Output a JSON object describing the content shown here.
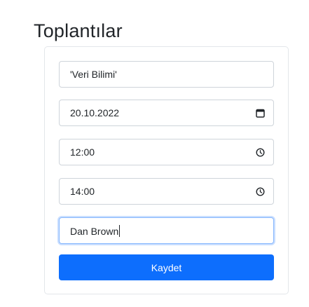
{
  "page": {
    "title": "Toplantılar"
  },
  "form": {
    "topic": {
      "value": "'Veri Bilimi'"
    },
    "date": {
      "value": "20.10.2022",
      "icon": "calendar-icon"
    },
    "start_time": {
      "value": "12:00",
      "icon": "clock-icon"
    },
    "end_time": {
      "value": "14:00",
      "icon": "clock-icon"
    },
    "participant": {
      "value": "Dan Brown"
    },
    "submit_label": "Kaydet"
  },
  "colors": {
    "primary": "#0d6efd",
    "focus_border": "#86b7fe",
    "border": "#ced4da"
  }
}
